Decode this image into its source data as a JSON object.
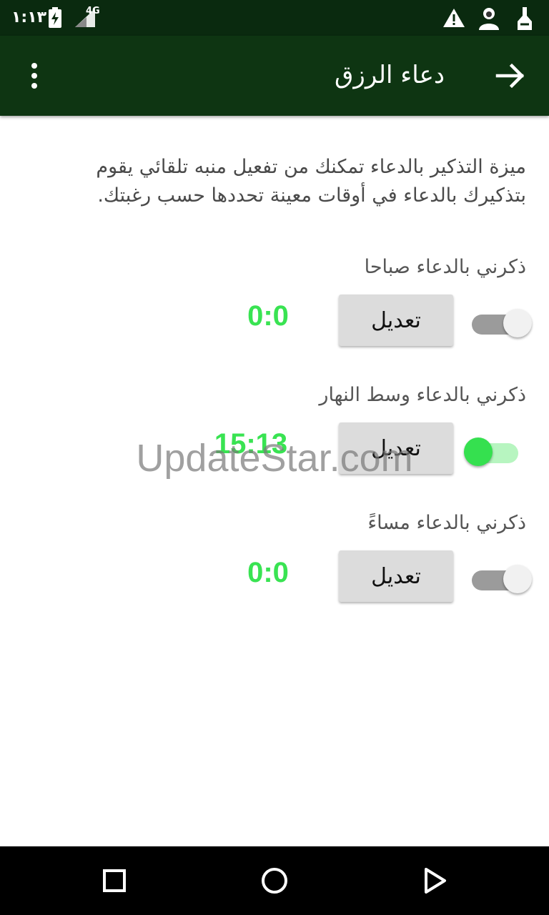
{
  "status_bar": {
    "time": "١:١٣",
    "network": "4G",
    "icons": [
      "battery-charging-icon",
      "signal-icon",
      "warning-icon",
      "avatar-icon",
      "app-notification-icon"
    ]
  },
  "app_bar": {
    "title": "دعاء الرزق",
    "menu_icon": "more-vert-icon",
    "back_icon": "arrow-forward-icon"
  },
  "content": {
    "description": "ميزة التذكير بالدعاء تمكنك من تفعيل منبه تلقائي يقوم بتذكيرك بالدعاء في أوقات معينة تحددها حسب رغبتك.",
    "reminders": [
      {
        "label": "ذكرني بالدعاء صباحا",
        "time": "0:0",
        "edit_label": "تعديل",
        "enabled": false
      },
      {
        "label": "ذكرني بالدعاء وسط النهار",
        "time": "15:13",
        "edit_label": "تعديل",
        "enabled": true
      },
      {
        "label": "ذكرني بالدعاء مساءً",
        "time": "0:0",
        "edit_label": "تعديل",
        "enabled": false
      }
    ]
  },
  "watermark": "UpdateStar.com",
  "colors": {
    "status_bar": "#0a2a0f",
    "app_bar": "#0e3512",
    "time_green": "#39e352",
    "switch_on": "#35e04f"
  },
  "nav_bar": {
    "buttons": [
      "recents-square-icon",
      "home-circle-icon",
      "back-triangle-icon"
    ]
  }
}
